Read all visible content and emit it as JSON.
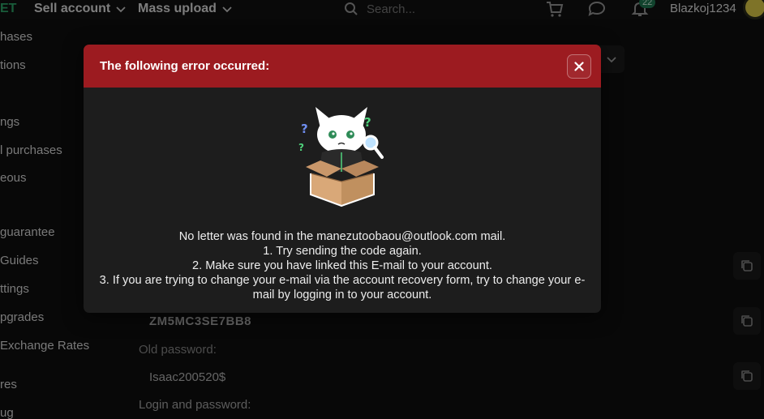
{
  "topbar": {
    "logo_fragment": "ET",
    "nav": [
      {
        "label": "Sell account"
      },
      {
        "label": "Mass upload"
      }
    ],
    "search_placeholder": "Search...",
    "notifications_count": "22",
    "username": "Blazkoj1234"
  },
  "sidebar": {
    "items": [
      {
        "label": "hases"
      },
      {
        "label": "tions"
      },
      {
        "label": "ngs"
      },
      {
        "label": "l purchases"
      },
      {
        "label": "eous"
      },
      {
        "label": "guarantee"
      },
      {
        "label": "Guides"
      },
      {
        "label": "ttings"
      },
      {
        "label": "pgrades"
      },
      {
        "label": "Exchange Rates"
      },
      {
        "label": "res"
      },
      {
        "label": "ug"
      }
    ]
  },
  "background": {
    "code_value": "ZM5MC3SE7BB8",
    "old_password_label": "Old password:",
    "old_password_value": "Isaac200520$",
    "login_password_label": "Login and password:"
  },
  "modal": {
    "title": "The following error occurred:",
    "lines": [
      "No letter was found in the manezutoobaou@outlook.com mail.",
      "1. Try sending the code again.",
      "2. Make sure you have linked this E-mail to your account.",
      "3. If you are trying to change your e-mail via the account recovery form, try to change your e-mail by logging in to your account."
    ]
  },
  "colors": {
    "modal_header": "#9c1b20",
    "modal_body": "#1d1d1d",
    "page_bg": "#0f0f0f",
    "accent_green": "#2ea86b"
  },
  "icons": {
    "cart": "cart-icon",
    "chat": "chat-icon",
    "bell": "bell-icon",
    "search": "search-icon",
    "close": "close-icon",
    "copy": "copy-icon",
    "chevron": "chevron-down-icon"
  }
}
